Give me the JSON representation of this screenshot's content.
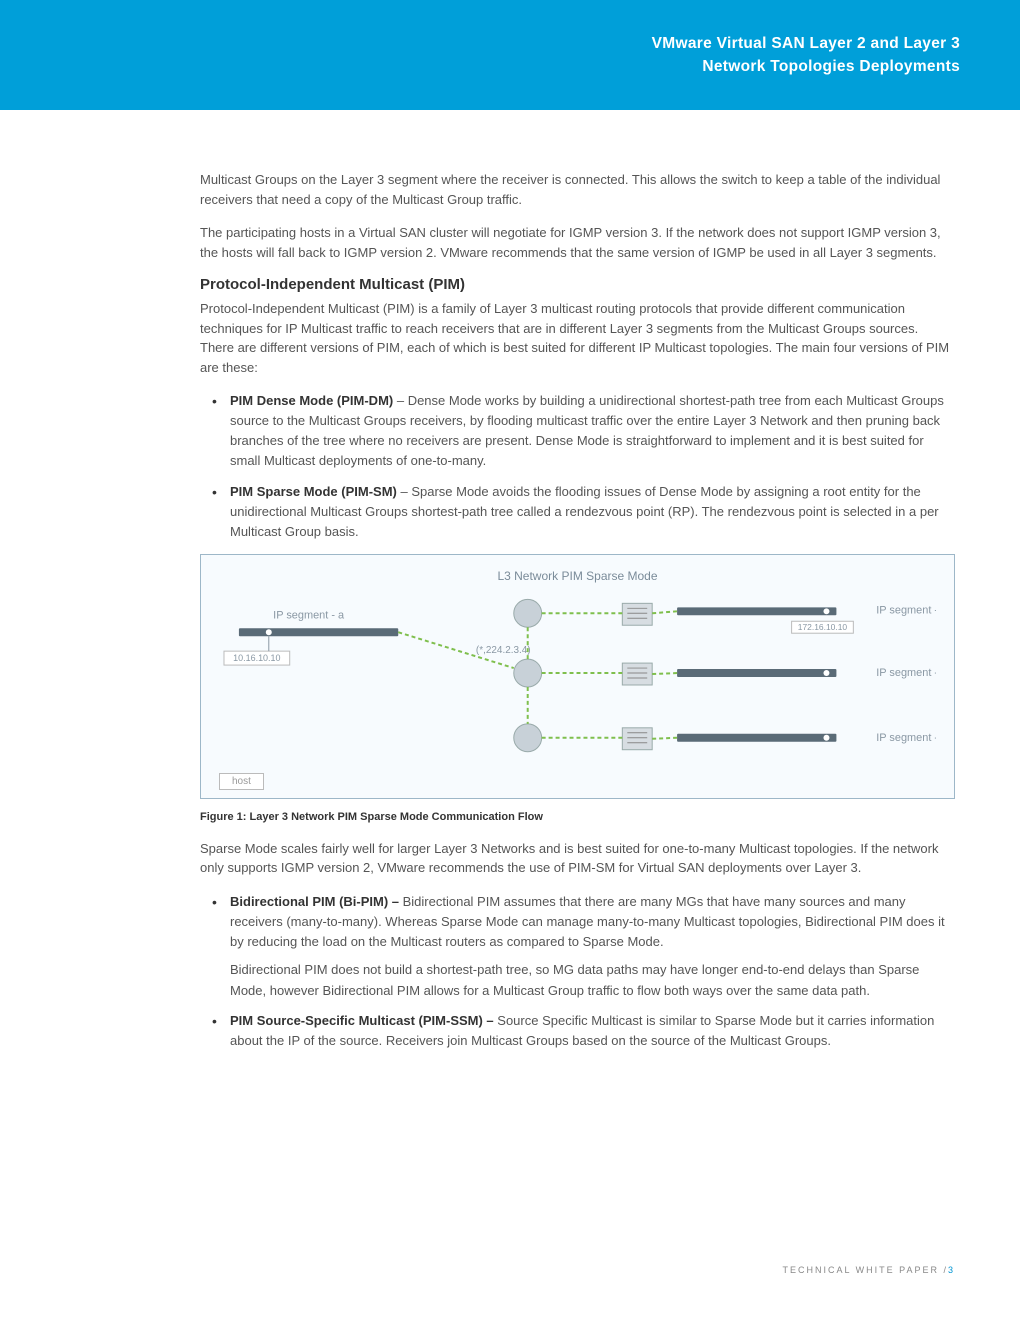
{
  "header": {
    "line1": "VMware Virtual SAN Layer 2 and Layer 3",
    "line2": "Network Topologies Deployments"
  },
  "paragraphs": {
    "p1": "Multicast Groups on the Layer 3 segment where the receiver is connected. This allows the switch to keep a table of the individual receivers that need a copy of the Multicast Group traffic.",
    "p2": "The participating hosts in a Virtual SAN cluster will negotiate for IGMP version 3. If the network does not support IGMP version 3, the hosts will fall back to IGMP version 2. VMware recommends that the same version of IGMP be used in all Layer 3 segments.",
    "p3": "Protocol-Independent Multicast (PIM) is a family of Layer 3 multicast routing protocols that provide different communication techniques for IP Multicast traffic to reach receivers that are in different Layer 3 segments from the Multicast Groups sources. There are different versions of PIM, each of which is best suited for different IP Multicast topologies. The main four versions of PIM are these:",
    "p4": "Sparse Mode scales fairly well for larger Layer 3 Networks and is best suited for one-to-many Multicast topologies. If the network only supports IGMP version 2, VMware recommends the use of PIM-SM for Virtual SAN deployments over Layer 3."
  },
  "section": {
    "pim": "Protocol-Independent Multicast (PIM)"
  },
  "bullets1": {
    "b1_bold": "PIM Dense Mode (PIM-DM)",
    "b1_text": " – Dense Mode works by building a unidirectional shortest-path tree from each Multicast Groups source to the Multicast Groups receivers, by flooding multicast traffic over the entire Layer 3 Network and then pruning back branches of the tree where no receivers are present. Dense Mode is straightforward to implement and it is best suited for small Multicast deployments of one-to-many.",
    "b2_bold": "PIM Sparse Mode (PIM-SM)",
    "b2_text": " – Sparse Mode avoids the flooding issues of Dense Mode by assigning a root entity for the unidirectional Multicast Groups shortest-path tree called a rendezvous point (RP). The rendezvous point is selected in a per Multicast Group basis."
  },
  "bullets2": {
    "b1_bold": "Bidirectional PIM (Bi-PIM) –",
    "b1_text": " Bidirectional PIM assumes that there are many MGs that have many sources and many receivers (many-to-many). Whereas Sparse Mode can manage many-to-many Multicast topologies, Bidirectional PIM does it by reducing the load on the Multicast routers as compared to Sparse Mode.",
    "b1_sub": "Bidirectional PIM does not build a shortest-path tree, so MG data paths may have longer end-to-end delays than Sparse Mode, however Bidirectional PIM allows for a Multicast Group traffic to flow both ways over the same data path.",
    "b2_bold": "PIM Source-Specific Multicast (PIM-SSM) –",
    "b2_text": " Source Specific Multicast is similar to Sparse Mode but it carries information about the IP of the source. Receivers join Multicast Groups based on the source of the Multicast Groups."
  },
  "figure": {
    "title": "L3 Network PIM Sparse Mode",
    "seg_a": "IP segment - a",
    "seg_b": "IP segment - b",
    "seg_c": "IP segment - c",
    "seg_d": "IP segment - d",
    "ip_left": "10.16.10.10",
    "ip_right": "172.16.10.10",
    "mcast": "(*,224.2.3.4)",
    "host": "host"
  },
  "caption": "Figure 1: Layer 3 Network PIM Sparse Mode Communication Flow",
  "footer": {
    "label": "TECHNICAL WHITE PAPER /",
    "page": "3"
  }
}
